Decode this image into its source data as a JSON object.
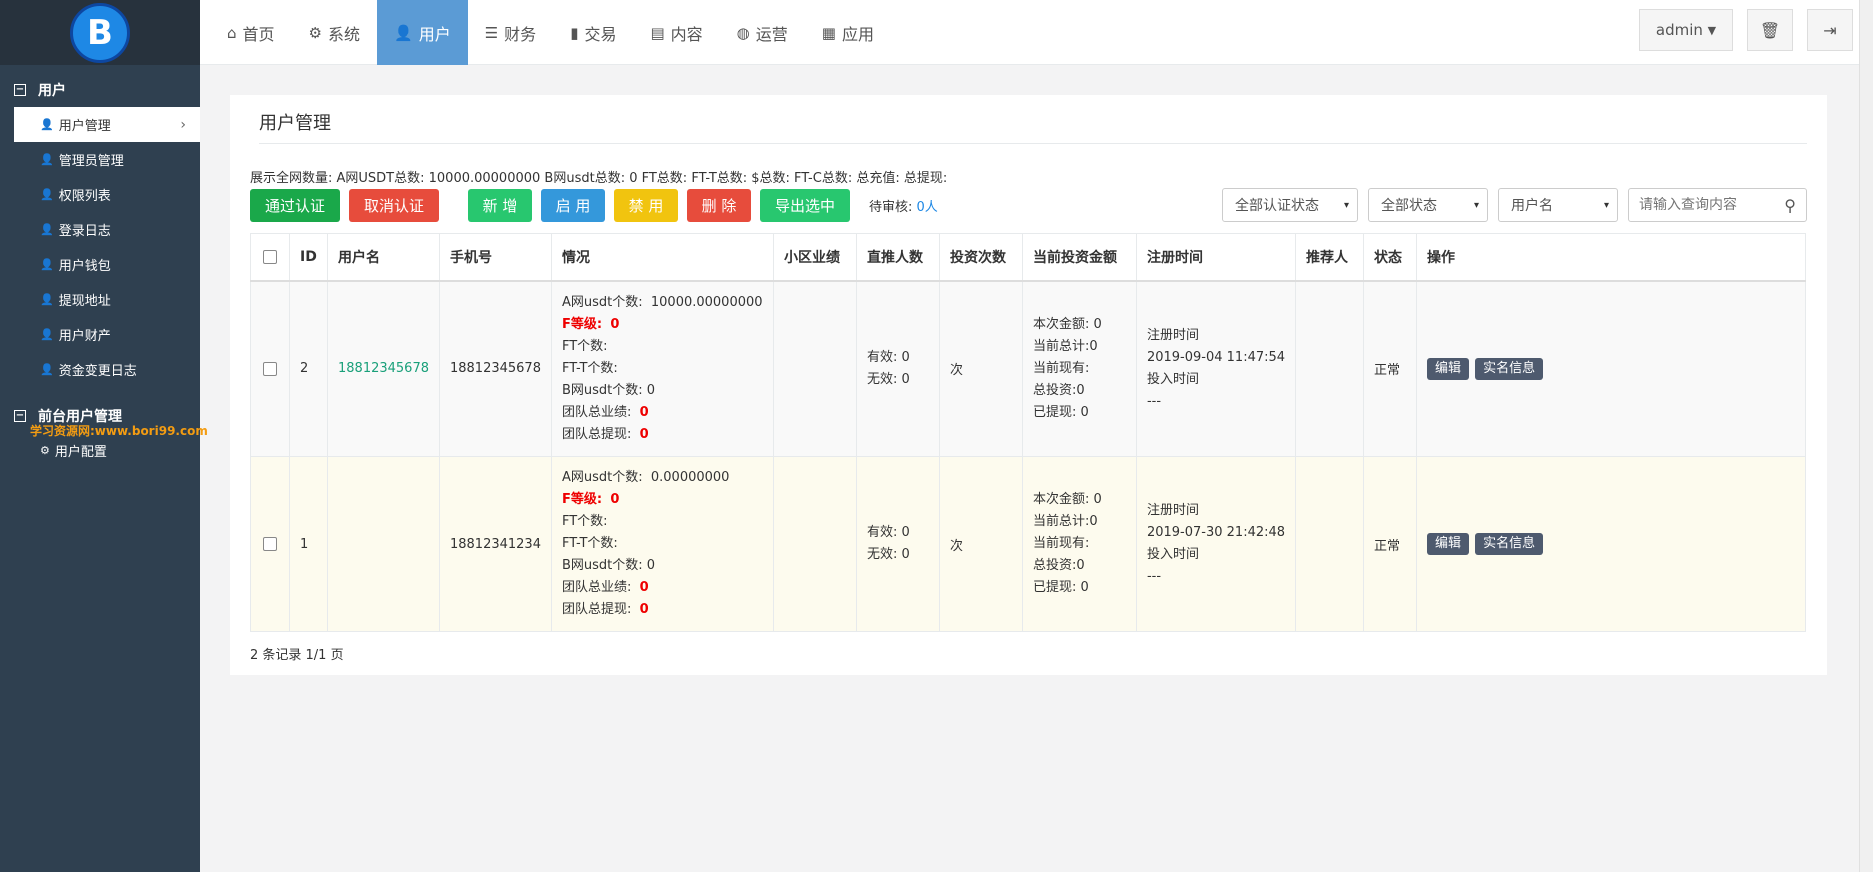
{
  "sidebar": {
    "logo": "B",
    "section_user": "用户",
    "items": [
      {
        "label": "用户管理"
      },
      {
        "label": "管理员管理"
      },
      {
        "label": "权限列表"
      },
      {
        "label": "登录日志"
      },
      {
        "label": "用户钱包"
      },
      {
        "label": "提现地址"
      },
      {
        "label": "用户财产"
      },
      {
        "label": "资金变更日志"
      }
    ],
    "section_front": "前台用户管理",
    "front_items": [
      {
        "label": "用户配置"
      }
    ],
    "watermark": "学习资源网:www.bori99.com"
  },
  "nav": {
    "items": [
      {
        "label": "首页",
        "icon": "home-icon"
      },
      {
        "label": "系统",
        "icon": "gear-icon"
      },
      {
        "label": "用户",
        "icon": "user-icon"
      },
      {
        "label": "财务",
        "icon": "list-icon"
      },
      {
        "label": "交易",
        "icon": "bar-chart-icon"
      },
      {
        "label": "内容",
        "icon": "document-icon"
      },
      {
        "label": "运营",
        "icon": "globe-icon"
      },
      {
        "label": "应用",
        "icon": "grid-icon"
      }
    ],
    "admin_label": "admin"
  },
  "card": {
    "title": "用户管理",
    "stats": "展示全网数量:   A网USDT总数:   10000.00000000  B网usdt总数: 0  FT总数:  FT-T总数:     $总数:     FT-C总数:     总充值:  总提现:",
    "buttons": {
      "approve": "通过认证",
      "cancel": "取消认证",
      "add": "新 增",
      "enable": "启 用",
      "disable": "禁 用",
      "delete": "删 除",
      "export": "导出选中"
    },
    "pending_label": "待审核:",
    "pending_num": "0人",
    "filters": {
      "auth": "全部认证状态",
      "status": "全部状态",
      "field": "用户名",
      "search_placeholder": "请输入查询内容"
    }
  },
  "table": {
    "headers": [
      "ID",
      "用户名",
      "手机号",
      "情况",
      "小区业绩",
      "直推人数",
      "投资次数",
      "当前投资金额",
      "注册时间",
      "推荐人",
      "状态",
      "操作"
    ],
    "rows": [
      {
        "id": "2",
        "username": "18812345678",
        "phone": "18812345678",
        "info": {
          "a_label": "A网usdt个数:",
          "a_val": "10000.00000000",
          "f_label": "F等级:",
          "f_val": "0",
          "ft": "FT个数:",
          "ftt": "FT-T个数:",
          "b": "B网usdt个数: 0",
          "team_perf_label": "团队总业绩:",
          "team_perf_val": "0",
          "team_wd_label": "团队总提现:",
          "team_wd_val": "0"
        },
        "direct_valid": "有效:  0",
        "direct_invalid": "无效:  0",
        "invest_times": "次",
        "amount": [
          "本次金额: 0",
          "当前总计:0",
          "当前现有:",
          "总投资:0",
          "已提现:  0"
        ],
        "reg_label": "注册时间",
        "reg_time": "2019-09-04 11:47:54",
        "invest_label": "投入时间",
        "invest_time": "---",
        "status": "正常"
      },
      {
        "id": "1",
        "username": "",
        "phone": "18812341234",
        "info": {
          "a_label": "A网usdt个数:",
          "a_val": "0.00000000",
          "f_label": "F等级:",
          "f_val": "0",
          "ft": "FT个数:",
          "ftt": "FT-T个数:",
          "b": "B网usdt个数: 0",
          "team_perf_label": "团队总业绩:",
          "team_perf_val": "0",
          "team_wd_label": "团队总提现:",
          "team_wd_val": "0"
        },
        "direct_valid": "有效:  0",
        "direct_invalid": "无效:  0",
        "invest_times": "次",
        "amount": [
          "本次金额: 0",
          "当前总计:0",
          "当前现有:",
          "总投资:0",
          "已提现:  0"
        ],
        "reg_label": "注册时间",
        "reg_time": "2019-07-30 21:42:48",
        "invest_label": "投入时间",
        "invest_time": "---",
        "status": "正常"
      }
    ],
    "op_edit": "编辑",
    "op_realname": "实名信息",
    "footer": "2 条记录 1/1 页"
  }
}
